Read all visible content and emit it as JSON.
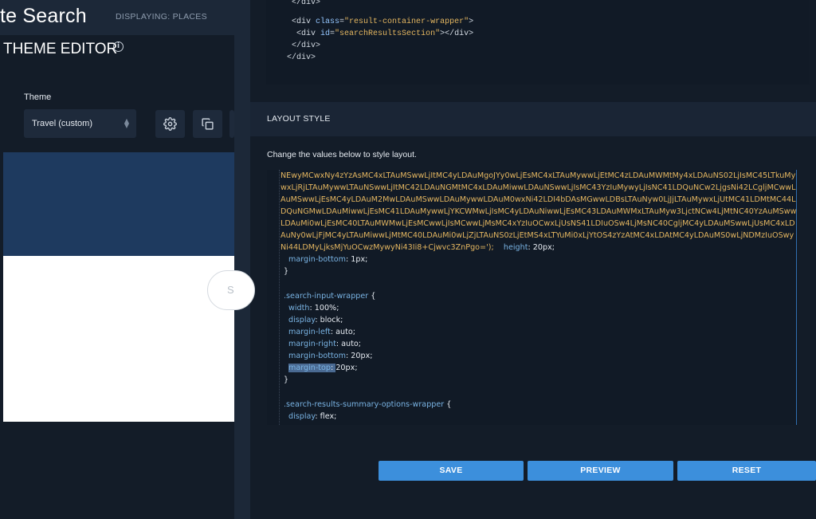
{
  "header": {
    "app_title": "te Search",
    "displaying": "DISPLAYING: PLACES"
  },
  "editor": {
    "title": "THEME EDITOR",
    "info_icon": "info-icon",
    "theme_label": "Theme",
    "theme_value": "Travel (custom)",
    "preview_placeholder_letter": "S"
  },
  "code_top": {
    "lines": [
      [
        "</div>"
      ],
      [
        "<div ",
        "class",
        "=",
        "\"result-container-wrapper\"",
        ">"
      ],
      [
        "<div ",
        "id",
        "=",
        "\"searchResultsSection\"",
        "></div>"
      ],
      [
        "</div>"
      ],
      [
        "</div>"
      ]
    ]
  },
  "layout": {
    "title": "LAYOUT STYLE",
    "subtitle": "Change the values below to style layout.",
    "base64_lines": [
      "NEwyMCwxNy4zYzAsMC4xLTAuMSwwLjItMC4yLDAuMgoJYy0wLjEsMC4xLTAuMywwLjEtMC4zLDAuMWMtMy4xLDAuNS02LjIsMC45LTkuMy",
      "wxLjRjLTAuMywwLTAuNSwwLjItMC42LDAuNGMtMC4xLDAuMiwwLDAuNSwwLjIsMC43YzIuMywyLjIsNC41LDQuNCw2LjgsNi42LCgljMCwwLD",
      "AuMSwwLjEsMC4yLDAuM2MwLDAuMSwwLDAuMywwLDAuM0wxNi42LDI4bDAsMGwwLDBsLTAuNyw0LjJjLTAuMywxLjUtMC41LDMtMC44L",
      "DQuNGMwLDAuMiwwLjEsMC41LDAuMywwLjYKCWMwLjIsMC4yLDAuNiwwLjEsMC43LDAuMWMxLTAuMyw3LjctNCw4LjMtNC40YzAuMSww",
      "LDAuMi0wLjEsMC40LTAuMWMwLjEsMCwwLjIsMCwwLjMsMC4xYzIuOCwxLjUsNS41LDIuOSw4LjMsNC40CgljMC4yLDAuMSwwLjUsMC4xLD",
      "AuNy0wLjFjMC4yLTAuMiwwLjMtMC40LDAuMi0wLjZjLTAuNS0zLjEtMS4xLTYuMi0xLjYtOS4zYzAtMC4xLDAtMC4yLDAuMS0wLjNDMzIuOSwy",
      "Ni44LDMyLjksMjYuOCwzMywyNi43Ii8+Cjwvc3ZnPgo=');"
    ],
    "height_prop": "height",
    "height_val": "20px",
    "css_blocks": {
      "mb_prop": "margin-bottom",
      "mb_val": "1px",
      "selector1": ".search-input-wrapper",
      "width_prop": "width",
      "width_val": "100%",
      "display_prop": "display",
      "display_val": "block",
      "ml_prop": "margin-left",
      "ml_val": "auto",
      "mr_prop": "margin-right",
      "mr_val": "auto",
      "mb2_prop": "margin-bottom",
      "mb2_val": "20px",
      "mt_prop": "margin-top",
      "mt_val": "20px",
      "selector2": ".search-results-summary-options-wrapper",
      "display2_prop": "display",
      "display2_val": "flex"
    }
  },
  "buttons": {
    "save": "SAVE",
    "preview": "PREVIEW",
    "reset": "RESET"
  },
  "colors": {
    "accent": "#3c8fdc",
    "background": "#131c28",
    "preview_header": "#1e3a5f"
  }
}
